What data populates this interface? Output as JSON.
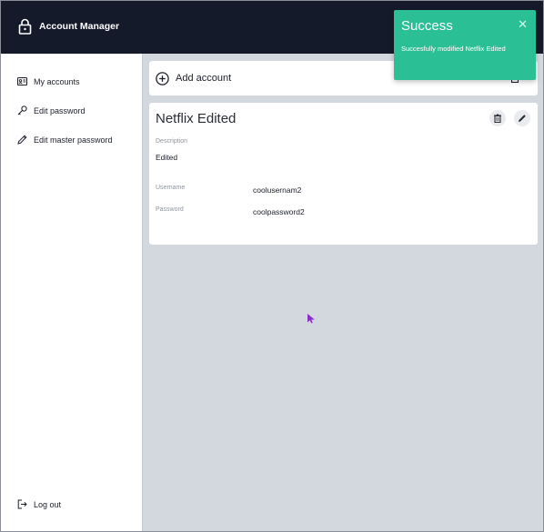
{
  "app": {
    "title": "Account Manager",
    "icon": "lock-icon"
  },
  "sidebar": {
    "items": [
      {
        "label": "My accounts",
        "icon": "id-card-icon"
      },
      {
        "label": "Edit password",
        "icon": "key-icon"
      },
      {
        "label": "Edit master password",
        "icon": "pencil-icon"
      }
    ],
    "logout_label": "Log out",
    "logout_icon": "logout-icon"
  },
  "main": {
    "add_account_label": "Add account",
    "add_account_icon": "plus-circle-icon",
    "secondary_action_icon": "trash-icon"
  },
  "card": {
    "title": "Netflix Edited",
    "description_label": "Description",
    "description_value": "Edited",
    "username_label": "Username",
    "username_value": "coolusernam2",
    "password_label": "Password",
    "password_value": "coolpassword2",
    "delete_icon": "trash-icon",
    "edit_icon": "pencil-icon"
  },
  "toast": {
    "title": "Success",
    "message": "Succesfully modified Netflix Edited",
    "close_icon": "close-icon",
    "color": "#2bbf96"
  },
  "colors": {
    "topbar": "#141a29",
    "content_bg": "#d3d7de",
    "cursor": "#8b2fc9"
  }
}
